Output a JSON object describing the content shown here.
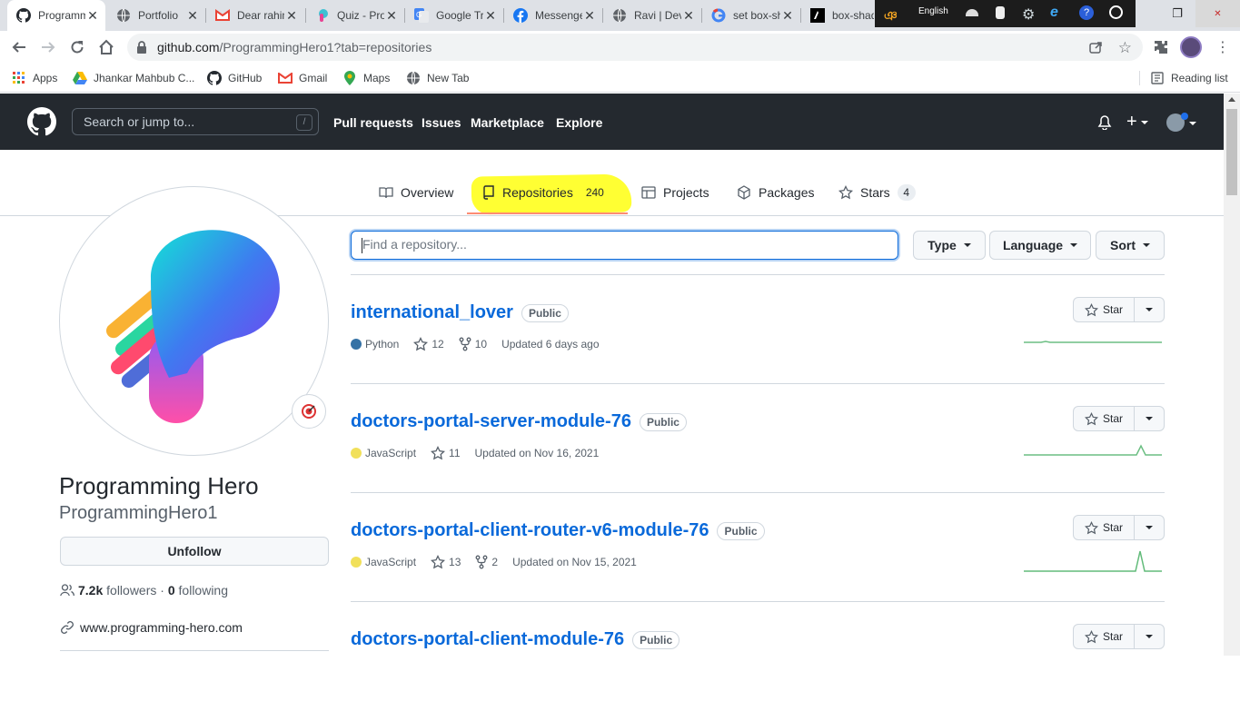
{
  "browser": {
    "tabs": [
      {
        "title": "Programming Hero",
        "active": true,
        "icon": "github-icon"
      },
      {
        "title": "Portfolio",
        "icon": "globe-icon"
      },
      {
        "title": "Dear rahim",
        "icon": "gmail-icon"
      },
      {
        "title": "Quiz - Programming Hero",
        "icon": "quiz-icon"
      },
      {
        "title": "Google Translate",
        "icon": "google-translate-icon"
      },
      {
        "title": "Messenger",
        "icon": "facebook-icon"
      },
      {
        "title": "Ravi | Dev",
        "icon": "globe-icon"
      },
      {
        "title": "set box-shadow",
        "icon": "google-icon"
      },
      {
        "title": "box-shadow",
        "icon": "mdn-icon"
      }
    ],
    "tray_language": "English",
    "url_host": "github.com",
    "url_path": "/ProgrammingHero1?tab=repositories",
    "bookmarks": [
      {
        "label": "Apps",
        "icon": "apps-grid-icon"
      },
      {
        "label": "Jhankar Mahbub C...",
        "icon": "drive-icon"
      },
      {
        "label": "GitHub",
        "icon": "github-icon"
      },
      {
        "label": "Gmail",
        "icon": "gmail-icon"
      },
      {
        "label": "Maps",
        "icon": "maps-icon"
      },
      {
        "label": "New Tab",
        "icon": "globe-icon"
      }
    ],
    "reading_list": "Reading list"
  },
  "github": {
    "search_placeholder": "Search or jump to...",
    "search_shortcut": "/",
    "nav": [
      "Pull requests",
      "Issues",
      "Marketplace",
      "Explore"
    ]
  },
  "profile_tabs": [
    {
      "label": "Overview",
      "icon": "book-icon"
    },
    {
      "label": "Repositories",
      "count": "240",
      "icon": "repo-icon",
      "active": true
    },
    {
      "label": "Projects",
      "icon": "project-icon"
    },
    {
      "label": "Packages",
      "icon": "package-icon"
    },
    {
      "label": "Stars",
      "count": "4",
      "icon": "star-icon"
    }
  ],
  "profile": {
    "name": "Programming Hero",
    "username": "ProgrammingHero1",
    "unfollow_label": "Unfollow",
    "followers": "7.2k",
    "followers_label": "followers",
    "following": "0",
    "following_label": "following",
    "separator": "·",
    "website": "www.programming-hero.com"
  },
  "filters": {
    "find_placeholder": "Find a repository...",
    "type": "Type",
    "language": "Language",
    "sort": "Sort"
  },
  "repos": [
    {
      "name": "international_lover",
      "visibility": "Public",
      "language": "Python",
      "language_color": "#3572A5",
      "stars": "12",
      "forks": "10",
      "updated": "Updated 6 days ago",
      "star_label": "Star"
    },
    {
      "name": "doctors-portal-server-module-76",
      "visibility": "Public",
      "language": "JavaScript",
      "language_color": "#f1e05a",
      "stars": "11",
      "forks": "",
      "updated": "Updated on Nov 16, 2021",
      "star_label": "Star"
    },
    {
      "name": "doctors-portal-client-router-v6-module-76",
      "visibility": "Public",
      "language": "JavaScript",
      "language_color": "#f1e05a",
      "stars": "13",
      "forks": "2",
      "updated": "Updated on Nov 15, 2021",
      "star_label": "Star"
    },
    {
      "name": "doctors-portal-client-module-76",
      "visibility": "Public",
      "language": "",
      "language_color": "",
      "stars": "",
      "forks": "",
      "updated": "",
      "star_label": "Star"
    }
  ],
  "colors": {
    "accent_link": "#0969da",
    "header_bg": "#24292f",
    "highlight": "#ffff33",
    "tab_underline": "#fd8c73",
    "sparkline": "#2da44e"
  }
}
